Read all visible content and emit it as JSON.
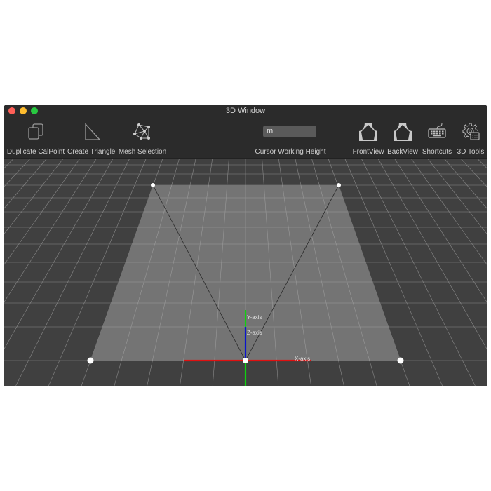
{
  "window": {
    "title": "3D Window"
  },
  "toolbar": {
    "left_tools": [
      {
        "label": "Duplicate CalPoint",
        "icon": "duplicate-icon"
      },
      {
        "label": "Create Triangle",
        "icon": "triangle-icon"
      },
      {
        "label": "Mesh Selection",
        "icon": "mesh-icon"
      }
    ],
    "cursor_height": {
      "value": "m",
      "label": "Cursor Working Height"
    },
    "right_tools": [
      {
        "label": "FrontView",
        "icon": "front-view-icon"
      },
      {
        "label": "BackView",
        "icon": "back-view-icon"
      },
      {
        "label": "Shortcuts",
        "icon": "keyboard-icon"
      },
      {
        "label": "3D Tools",
        "icon": "gear-tools-icon"
      }
    ]
  },
  "viewport": {
    "axis_labels": {
      "x": "X-axis",
      "y": "Y-axis",
      "z": "Z-axis"
    },
    "colors": {
      "background": "#404040",
      "plane": "#747474",
      "grid": "#8a8a8a",
      "x_axis": "#e01010",
      "y_axis": "#10d010",
      "z_axis": "#1010d0"
    }
  }
}
